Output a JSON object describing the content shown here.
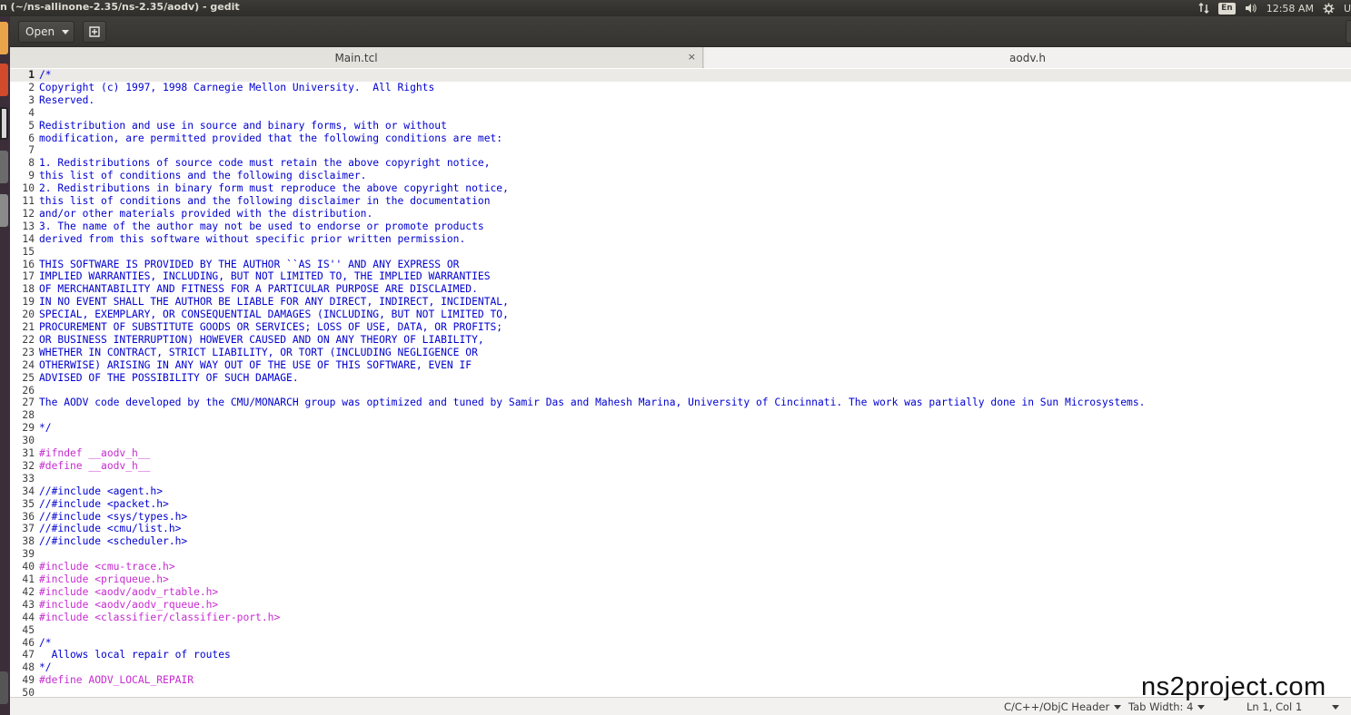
{
  "window": {
    "title": "n (~/ns-allinone-2.35/ns-2.35/aodv) - gedit"
  },
  "tray": {
    "lang": "En",
    "time": "12:58 AM",
    "user_fragment": "U"
  },
  "toolbar": {
    "open_label": "Open"
  },
  "tabs": [
    {
      "label": "Main.tcl",
      "close": "×"
    },
    {
      "label": "aodv.h"
    }
  ],
  "editor": {
    "current_line": 1,
    "lines": [
      {
        "n": "1",
        "t": "/*",
        "k": "comment"
      },
      {
        "n": "2",
        "t": "Copyright (c) 1997, 1998 Carnegie Mellon University.  All Rights",
        "k": "comment"
      },
      {
        "n": "3",
        "t": "Reserved.",
        "k": "comment"
      },
      {
        "n": "4",
        "t": "",
        "k": "comment"
      },
      {
        "n": "5",
        "t": "Redistribution and use in source and binary forms, with or without",
        "k": "comment"
      },
      {
        "n": "6",
        "t": "modification, are permitted provided that the following conditions are met:",
        "k": "comment"
      },
      {
        "n": "7",
        "t": "",
        "k": "comment"
      },
      {
        "n": "8",
        "t": "1. Redistributions of source code must retain the above copyright notice,",
        "k": "comment"
      },
      {
        "n": "9",
        "t": "this list of conditions and the following disclaimer.",
        "k": "comment"
      },
      {
        "n": "10",
        "t": "2. Redistributions in binary form must reproduce the above copyright notice,",
        "k": "comment"
      },
      {
        "n": "11",
        "t": "this list of conditions and the following disclaimer in the documentation",
        "k": "comment"
      },
      {
        "n": "12",
        "t": "and/or other materials provided with the distribution.",
        "k": "comment"
      },
      {
        "n": "13",
        "t": "3. The name of the author may not be used to endorse or promote products",
        "k": "comment"
      },
      {
        "n": "14",
        "t": "derived from this software without specific prior written permission.",
        "k": "comment"
      },
      {
        "n": "15",
        "t": "",
        "k": "comment"
      },
      {
        "n": "16",
        "t": "THIS SOFTWARE IS PROVIDED BY THE AUTHOR ``AS IS'' AND ANY EXPRESS OR",
        "k": "comment"
      },
      {
        "n": "17",
        "t": "IMPLIED WARRANTIES, INCLUDING, BUT NOT LIMITED TO, THE IMPLIED WARRANTIES",
        "k": "comment"
      },
      {
        "n": "18",
        "t": "OF MERCHANTABILITY AND FITNESS FOR A PARTICULAR PURPOSE ARE DISCLAIMED.",
        "k": "comment"
      },
      {
        "n": "19",
        "t": "IN NO EVENT SHALL THE AUTHOR BE LIABLE FOR ANY DIRECT, INDIRECT, INCIDENTAL,",
        "k": "comment"
      },
      {
        "n": "20",
        "t": "SPECIAL, EXEMPLARY, OR CONSEQUENTIAL DAMAGES (INCLUDING, BUT NOT LIMITED TO,",
        "k": "comment"
      },
      {
        "n": "21",
        "t": "PROCUREMENT OF SUBSTITUTE GOODS OR SERVICES; LOSS OF USE, DATA, OR PROFITS;",
        "k": "comment"
      },
      {
        "n": "22",
        "t": "OR BUSINESS INTERRUPTION) HOWEVER CAUSED AND ON ANY THEORY OF LIABILITY,",
        "k": "comment"
      },
      {
        "n": "23",
        "t": "WHETHER IN CONTRACT, STRICT LIABILITY, OR TORT (INCLUDING NEGLIGENCE OR",
        "k": "comment"
      },
      {
        "n": "24",
        "t": "OTHERWISE) ARISING IN ANY WAY OUT OF THE USE OF THIS SOFTWARE, EVEN IF",
        "k": "comment"
      },
      {
        "n": "25",
        "t": "ADVISED OF THE POSSIBILITY OF SUCH DAMAGE.",
        "k": "comment"
      },
      {
        "n": "26",
        "t": "",
        "k": "comment"
      },
      {
        "n": "27",
        "t": "The AODV code developed by the CMU/MONARCH group was optimized and tuned by Samir Das and Mahesh Marina, University of Cincinnati. The work was partially done in Sun Microsystems.",
        "k": "comment"
      },
      {
        "n": "28",
        "t": "",
        "k": "comment"
      },
      {
        "n": "29",
        "t": "*/",
        "k": "comment"
      },
      {
        "n": "30",
        "t": "",
        "k": "plain"
      },
      {
        "n": "31",
        "t": "#ifndef __aodv_h__",
        "k": "pre"
      },
      {
        "n": "32",
        "t": "#define __aodv_h__",
        "k": "pre"
      },
      {
        "n": "33",
        "t": "",
        "k": "plain"
      },
      {
        "n": "34",
        "t": "//#include <agent.h>",
        "k": "comment"
      },
      {
        "n": "35",
        "t": "//#include <packet.h>",
        "k": "comment"
      },
      {
        "n": "36",
        "t": "//#include <sys/types.h>",
        "k": "comment"
      },
      {
        "n": "37",
        "t": "//#include <cmu/list.h>",
        "k": "comment"
      },
      {
        "n": "38",
        "t": "//#include <scheduler.h>",
        "k": "comment"
      },
      {
        "n": "39",
        "t": "",
        "k": "plain"
      },
      {
        "n": "40",
        "t": "#include <cmu-trace.h>",
        "k": "pre"
      },
      {
        "n": "41",
        "t": "#include <priqueue.h>",
        "k": "pre"
      },
      {
        "n": "42",
        "t": "#include <aodv/aodv_rtable.h>",
        "k": "pre"
      },
      {
        "n": "43",
        "t": "#include <aodv/aodv_rqueue.h>",
        "k": "pre"
      },
      {
        "n": "44",
        "t": "#include <classifier/classifier-port.h>",
        "k": "pre"
      },
      {
        "n": "45",
        "t": "",
        "k": "plain"
      },
      {
        "n": "46",
        "t": "/*",
        "k": "comment"
      },
      {
        "n": "47",
        "t": "  Allows local repair of routes",
        "k": "comment"
      },
      {
        "n": "48",
        "t": "*/",
        "k": "comment"
      },
      {
        "n": "49",
        "t": "#define AODV_LOCAL_REPAIR",
        "k": "pre"
      },
      {
        "n": "50",
        "t": "",
        "k": "plain"
      }
    ]
  },
  "statusbar": {
    "language": "C/C++/ObjC Header",
    "tab_width": "Tab Width: 4",
    "position": "Ln 1, Col 1"
  },
  "watermark": "ns2project.com",
  "colors": {
    "comment": "#0000d0",
    "preprocessor": "#c72bd1",
    "panel": "#3c3b37",
    "launcher": "#3b2e39"
  }
}
